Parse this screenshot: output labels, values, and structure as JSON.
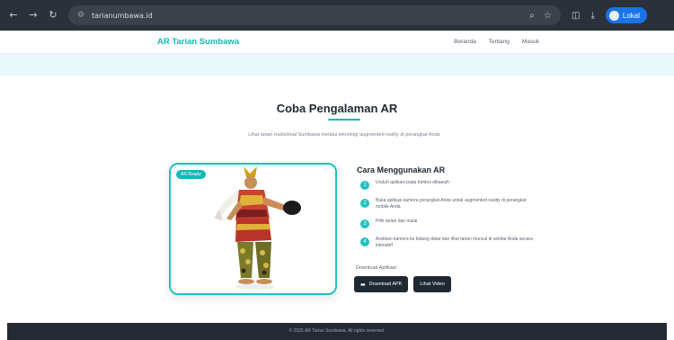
{
  "browser": {
    "back_icon": "back-arrow-icon",
    "forward_icon": "forward-arrow-icon",
    "reload_icon": "reload-icon",
    "url": "tarianumbawa.id",
    "profile_label": "Lokal"
  },
  "header": {
    "logo": "AR Tarian Sumbawa",
    "nav": [
      "Beranda",
      "Tentang",
      "Masuk"
    ]
  },
  "hero": {
    "title": "Coba Pengalaman AR",
    "subtitle": "Lihat tarian tradisional Sumbawa melalui teknologi augmented reality di perangkat Anda"
  },
  "card": {
    "badge": "AR Ready"
  },
  "instructions": {
    "title": "Cara Menggunakan AR",
    "steps": [
      {
        "num": "1",
        "text": "Unduh aplikasi pada tombol dibawah"
      },
      {
        "num": "2",
        "text": "Buka aplikasi kamera perangkat Anda untuk augmented reality di perangkat mobile Anda"
      },
      {
        "num": "3",
        "text": "Pilih tarian dan mulai"
      },
      {
        "num": "4",
        "text": "Arahkan kamera ke bidang datar dan lihat tarian muncul di sekitar Anda secara interaktif"
      }
    ]
  },
  "download": {
    "label": "Download Aplikasi:",
    "primary": "Download APK",
    "secondary": "Lihat Video"
  },
  "footer": {
    "text": "© 2025 AR Tarian Sumbawa. All rights reserved."
  },
  "colors": {
    "accent": "#14b8b8",
    "dark": "#1f2933",
    "chrome": "#2b313a"
  }
}
